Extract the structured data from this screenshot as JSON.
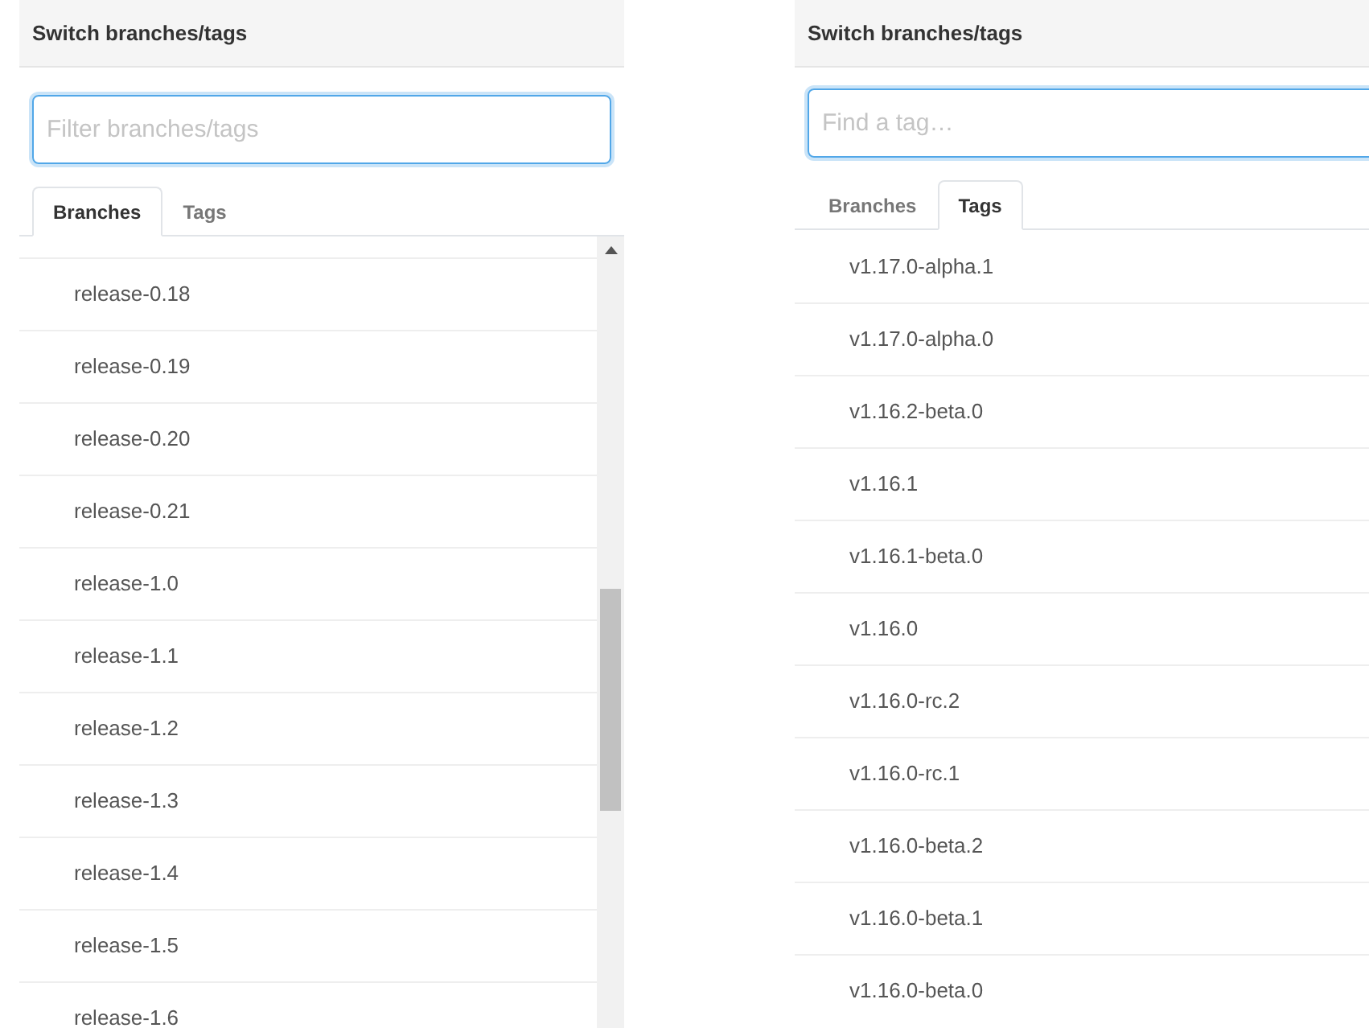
{
  "panels": [
    {
      "title": "Switch branches/tags",
      "filter": {
        "placeholder": "Filter branches/tags"
      },
      "tabs": [
        {
          "label": "Branches",
          "selected": true
        },
        {
          "label": "Tags",
          "selected": false
        }
      ],
      "scrollbar": true,
      "items": [
        "release-0.18",
        "release-0.19",
        "release-0.20",
        "release-0.21",
        "release-1.0",
        "release-1.1",
        "release-1.2",
        "release-1.3",
        "release-1.4",
        "release-1.5",
        "release-1.6"
      ]
    },
    {
      "title": "Switch branches/tags",
      "filter": {
        "placeholder": "Find a tag…"
      },
      "tabs": [
        {
          "label": "Branches",
          "selected": false
        },
        {
          "label": "Tags",
          "selected": true
        }
      ],
      "scrollbar": false,
      "items": [
        "v1.17.0-alpha.1",
        "v1.17.0-alpha.0",
        "v1.16.2-beta.0",
        "v1.16.1",
        "v1.16.1-beta.0",
        "v1.16.0",
        "v1.16.0-rc.2",
        "v1.16.0-rc.1",
        "v1.16.0-beta.2",
        "v1.16.0-beta.1",
        "v1.16.0-beta.0"
      ]
    }
  ]
}
